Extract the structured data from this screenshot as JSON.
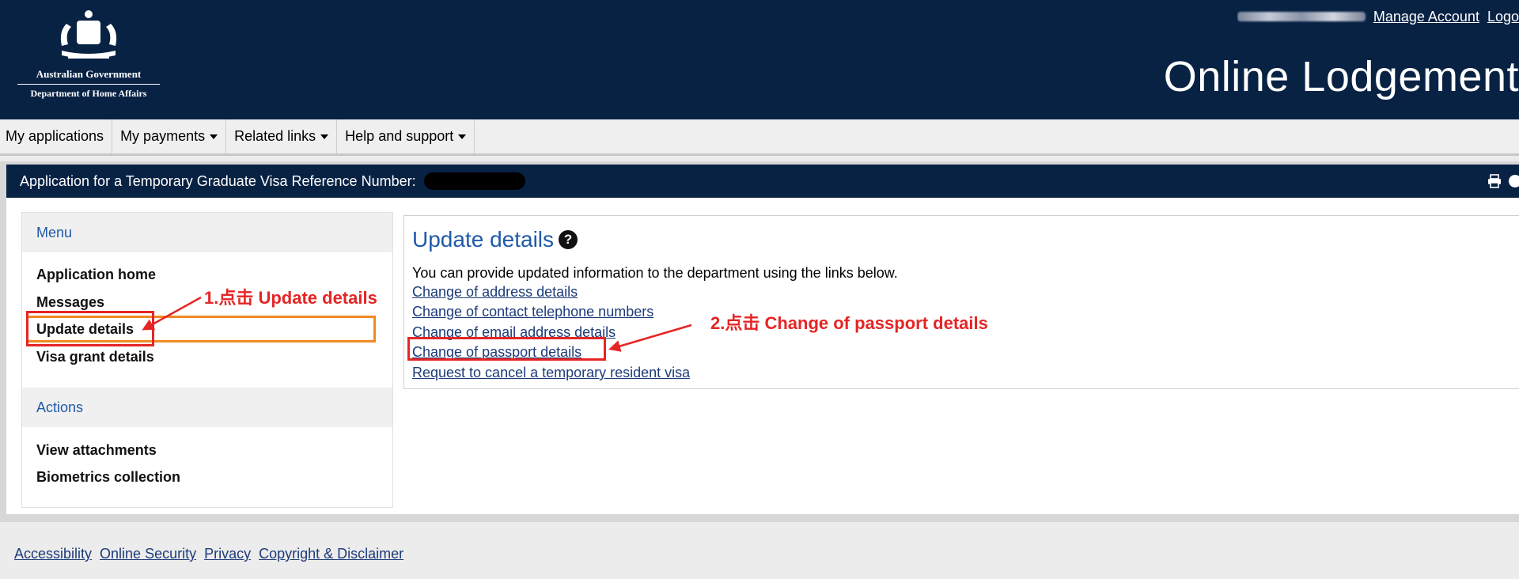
{
  "header": {
    "gov_name": "Australian Government",
    "department": "Department of Home Affairs",
    "manage_account": "Manage Account",
    "logout": "Logo",
    "app_title": "Online Lodgement"
  },
  "nav": {
    "items": [
      {
        "label": "My applications",
        "dropdown": false
      },
      {
        "label": "My payments",
        "dropdown": true
      },
      {
        "label": "Related links",
        "dropdown": true
      },
      {
        "label": "Help and support",
        "dropdown": true
      }
    ]
  },
  "application_bar": {
    "title": "Application for a Temporary Graduate Visa Reference Number:"
  },
  "menu": {
    "header": "Menu",
    "items": [
      "Application home",
      "Messages",
      "Update details",
      "Visa grant details"
    ],
    "actions_header": "Actions",
    "actions": [
      "View attachments",
      "Biometrics collection"
    ]
  },
  "panel": {
    "title": "Update details",
    "help_glyph": "?",
    "intro": "You can provide updated information to the department using the links below.",
    "links": [
      "Change of address details",
      "Change of contact telephone numbers",
      "Change of email address details",
      "Change of passport details",
      "Request to cancel a temporary resident visa"
    ]
  },
  "annotations": {
    "step1": "1.点击 Update details",
    "step2": "2.点击 Change of passport details",
    "color": "#e52525",
    "highlight_color": "#f08a24"
  },
  "footer": {
    "links": [
      "Accessibility",
      "Online Security",
      "Privacy",
      "Copyright & Disclaimer"
    ]
  },
  "colors": {
    "navy": "#082244",
    "link_blue": "#1c3b78",
    "heading_blue": "#1f5aa8"
  },
  "icons": {
    "print": "print-icon",
    "help": "help-icon"
  }
}
